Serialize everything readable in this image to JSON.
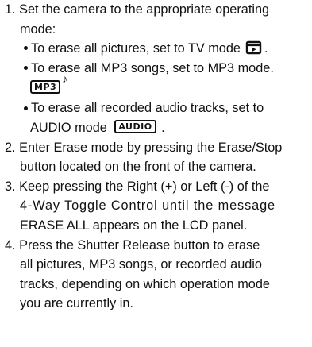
{
  "steps": [
    {
      "lines": [
        "1. Set the camera to the appropriate operating",
        "mode:"
      ]
    },
    {
      "lines": [
        "2. Enter Erase mode by pressing the Erase/Stop",
        "button located on the front of the camera."
      ]
    },
    {
      "lines": [
        "3. Keep pressing the Right (+) or Left (-) of the",
        "4-Way Toggle Control until the message",
        "ERASE ALL appears on the LCD panel."
      ]
    },
    {
      "lines": [
        "4. Press the Shutter Release button to erase",
        "all pictures, MP3 songs, or recorded audio",
        "tracks, depending on which operation mode",
        "you are currently in."
      ]
    }
  ],
  "bullets": [
    {
      "text": "To erase all pictures, set to TV mode",
      "after": "."
    },
    {
      "text": "To erase all MP3 songs, set to MP3 mode."
    },
    {
      "text": "To erase all recorded audio tracks, set to",
      "cont": "AUDIO mode",
      "after": "."
    }
  ],
  "icons": {
    "tv": "tv-playback-icon",
    "mp3": "MP3",
    "audio": "AUDIO"
  }
}
